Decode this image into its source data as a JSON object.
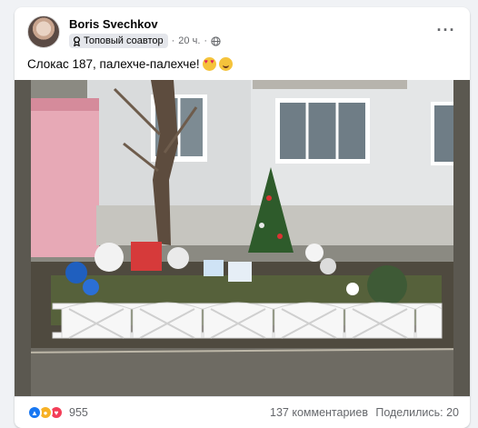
{
  "post": {
    "author": "Boris Svechkov",
    "badge_label": "Топовый соавтор",
    "separator": "·",
    "time": "20 ч.",
    "more_label": "···",
    "text": "Слокас 187, палехче-палехче!"
  },
  "icons": {
    "badge": "badge-icon",
    "privacy": "globe-icon",
    "emoji_1": "smiling-face-with-heart-eyes",
    "emoji_2": "grinning-face"
  },
  "photo": {
    "subject": "decorated front garden with small Christmas tree behind white picket fence"
  },
  "footer": {
    "reaction_count": "955",
    "comments": "137 комментариев",
    "shares": "Поделились: 20"
  },
  "colors": {
    "accent": "#1877f2",
    "muted_text": "#65676b",
    "haha": "#f7b125",
    "love": "#f33e58"
  }
}
